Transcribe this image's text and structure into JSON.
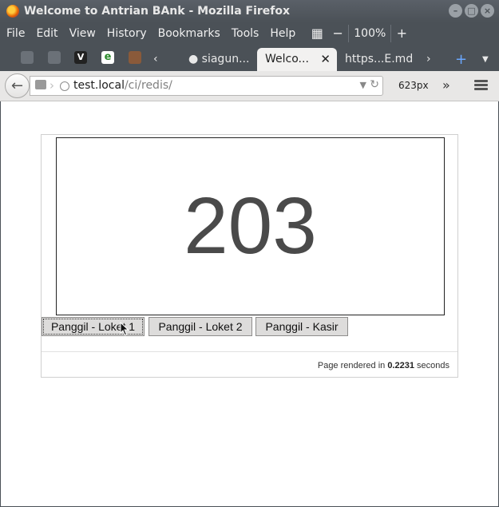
{
  "window": {
    "title": "Welcome to Antrian BAnk - Mozilla Firefox",
    "controls": [
      "–",
      "□",
      "×"
    ]
  },
  "menu": {
    "items": [
      "File",
      "Edit",
      "View",
      "History",
      "Bookmarks",
      "Tools",
      "Help"
    ],
    "zoom_level": "100%"
  },
  "tabs": [
    {
      "label": "siagun..."
    },
    {
      "label": "Welco...",
      "active": true
    },
    {
      "label": "https...E.md"
    }
  ],
  "nav": {
    "url_host": "test.local",
    "url_path": "/ci/redis/",
    "viewport_width_label": "623px"
  },
  "page": {
    "queue_number": "203",
    "buttons": [
      "Panggil - Loket 1",
      "Panggil - Loket 2",
      "Panggil - Kasir"
    ],
    "footer_prefix": "Page rendered in ",
    "footer_time": "0.2231",
    "footer_suffix": " seconds"
  },
  "colors": {
    "chrome": "#4b5157",
    "number": "#4a4a4a",
    "button_bg": "#dddcdb"
  }
}
